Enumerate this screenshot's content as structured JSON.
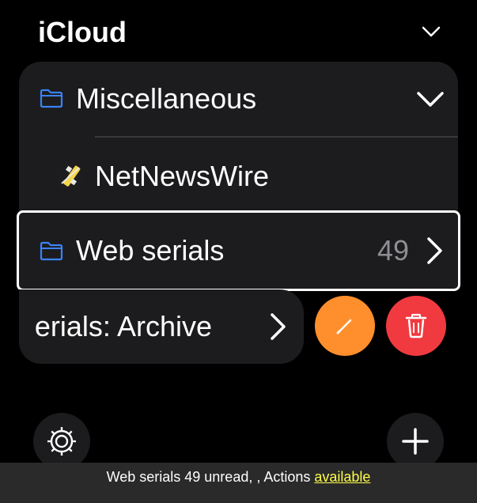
{
  "header": {
    "title": "iCloud",
    "chevron_icon": "chevron-down-icon"
  },
  "sidebar": {
    "items": [
      {
        "label": "Miscellaneous",
        "icon": "folder-icon",
        "expanded": true
      },
      {
        "label": "NetNewsWire",
        "icon": "netnewswire-icon"
      },
      {
        "label": "Web serials",
        "icon": "folder-icon",
        "unread": "49",
        "selected": true
      },
      {
        "label": "erials: Archive",
        "icon": "chevron-right-icon"
      }
    ]
  },
  "row_actions": {
    "edit_icon": "pencil-icon",
    "delete_icon": "trash-icon"
  },
  "toolbar": {
    "settings_icon": "gear-icon",
    "add_icon": "plus-icon"
  },
  "status": {
    "text": "Web serials  49 unread, , Actions ",
    "link": "available"
  },
  "colors": {
    "accent_folder": "#3b82f6",
    "edit": "#ff8f2c",
    "delete": "#f13a40",
    "status_link": "#fdfd4b"
  }
}
